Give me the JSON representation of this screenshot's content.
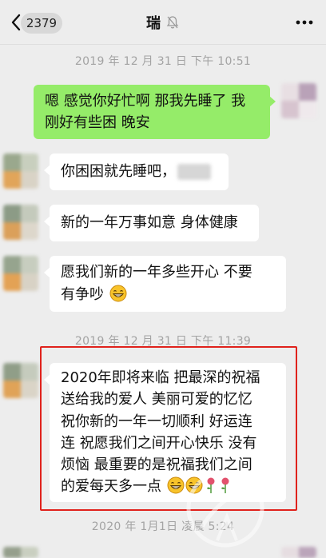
{
  "header": {
    "back_icon": "chevron-left-icon",
    "unread_count": "2379",
    "title": "瑞",
    "mute_icon": "bell-muted-icon",
    "more_icon": "more-dots-icon"
  },
  "messages": {
    "ts1": "2019 年 12 月 31 日  下午 10:51",
    "msg1_line1": "嗯 感觉你好忙啊 那我先睡了 我",
    "msg1_line2": "刚好有些困 晚安",
    "msg2": "你困困就先睡吧，",
    "msg3": "新的一年万事如意 身体健康",
    "msg4_line1": "愿我们新的一年多些开心 不要",
    "msg4_line2": "有争吵",
    "ts2": "2019 年 12 月 31 日  下午 11:39",
    "msg5_lines": [
      "2020年即将来临 把最深的祝福",
      "送给我的爱人 美丽可爱的忆忆",
      "祝你新的一年一切顺利 好运连",
      "连 祝愿我们之间开心快乐 没有",
      "烦恼 最重要的是祝福我们之间",
      "的爱每天多一点"
    ],
    "ts3": "2020 年 1月1日  凌晨 5:24"
  },
  "colors": {
    "incoming_bubble": "#ffffff",
    "outgoing_bubble": "#95ec69",
    "highlight_border": "#e0221c"
  }
}
